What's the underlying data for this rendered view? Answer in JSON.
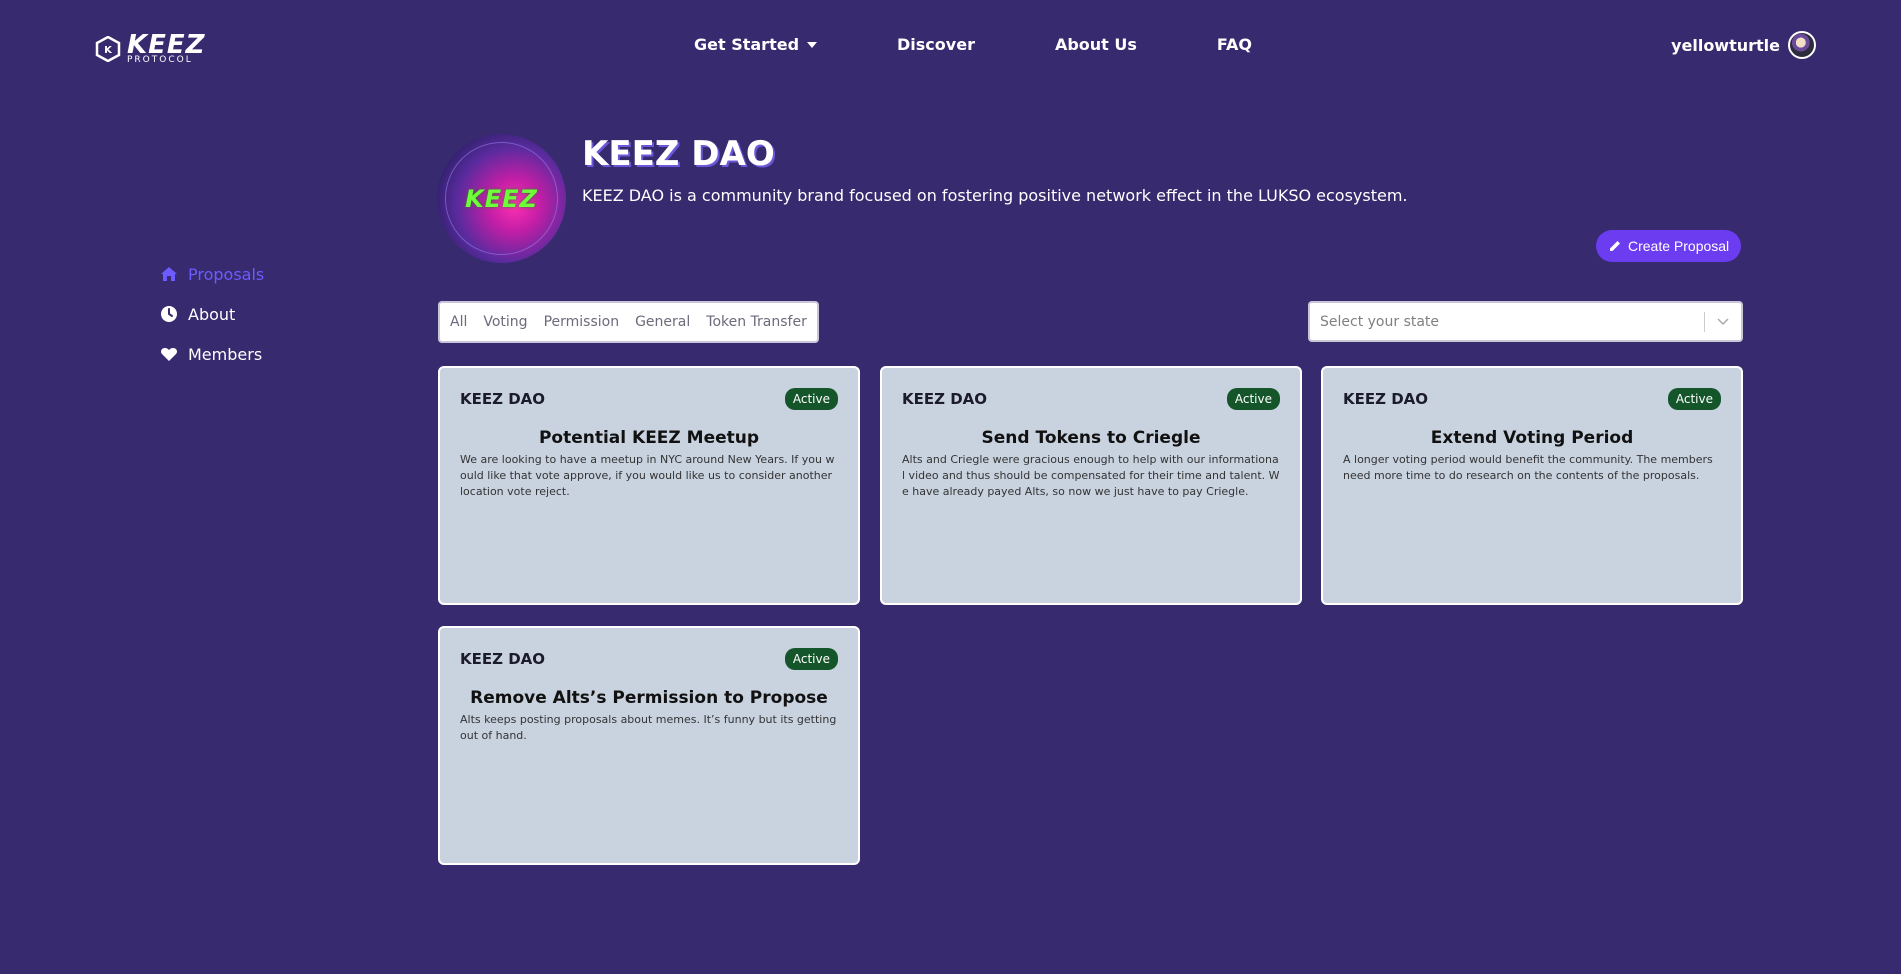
{
  "header": {
    "logo_main": "KEEZ",
    "logo_sub": "PROTOCOL",
    "nav": [
      {
        "label": "Get Started"
      },
      {
        "label": "Discover"
      },
      {
        "label": "About Us"
      },
      {
        "label": "FAQ"
      }
    ],
    "username": "yellowturtle"
  },
  "sidebar": {
    "items": [
      {
        "label": "Proposals",
        "icon": "home-icon",
        "active": true
      },
      {
        "label": "About",
        "icon": "clock-icon",
        "active": false
      },
      {
        "label": "Members",
        "icon": "heart-icon",
        "active": false
      }
    ]
  },
  "dao": {
    "avatar_text": "KEEZ",
    "title": "KEEZ DAO",
    "description": "KEEZ DAO is a community brand focused on fostering positive network effect in the LUKSO ecosystem.",
    "create_label": "Create Proposal"
  },
  "filters": [
    "All",
    "Voting",
    "Permission",
    "General",
    "Token Transfer"
  ],
  "state_select": {
    "placeholder": "Select your state"
  },
  "proposals": [
    {
      "dao": "KEEZ DAO",
      "status": "Active",
      "title": "Potential KEEZ Meetup",
      "body": "We are looking to have a meetup in NYC around New Years. If you would like that vote approve, if you would like us to consider another location vote reject."
    },
    {
      "dao": "KEEZ DAO",
      "status": "Active",
      "title": "Send Tokens to Criegle",
      "body": "Alts and Criegle were gracious enough to help with our informational video and thus should be compensated for their time and talent. We have already payed Alts, so now we just have to pay Criegle."
    },
    {
      "dao": "KEEZ DAO",
      "status": "Active",
      "title": "Extend Voting Period",
      "body": "A longer voting period would benefit the community. The members need more time to do research on the contents of the proposals."
    },
    {
      "dao": "KEEZ DAO",
      "status": "Active",
      "title": "Remove Alts’s Permission to Propose",
      "body": "Alts keeps posting proposals about memes. It’s funny but its getting out of hand."
    }
  ],
  "colors": {
    "background": "#372a6e",
    "accent": "#6c3cf0",
    "active_sidebar": "#6c5cff",
    "badge": "#14552a",
    "card": "#c9d3e0"
  }
}
